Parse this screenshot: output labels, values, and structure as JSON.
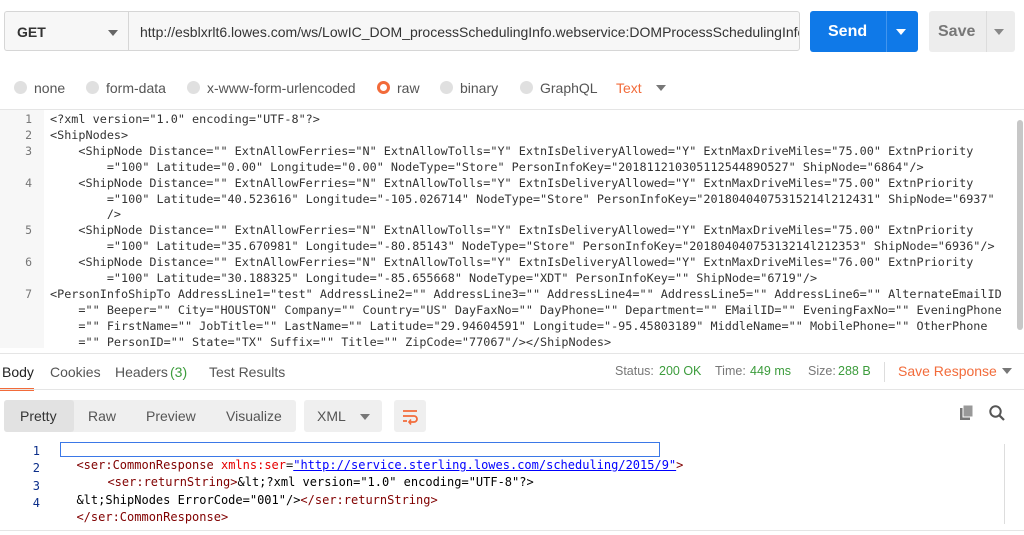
{
  "request": {
    "method": "GET",
    "url": "http://esblxrlt6.lowes.com/ws/LowIC_DOM_processSchedulingInfo.webservice:DOMProcessSchedulingInfo",
    "send_label": "Send",
    "save_label": "Save"
  },
  "body_types": [
    {
      "label": "none",
      "selected": false
    },
    {
      "label": "form-data",
      "selected": false
    },
    {
      "label": "x-www-form-urlencoded",
      "selected": false
    },
    {
      "label": "raw",
      "selected": true
    },
    {
      "label": "binary",
      "selected": false
    },
    {
      "label": "GraphQL",
      "selected": false
    }
  ],
  "raw_format": "Text",
  "request_body": {
    "line_numbers": [
      "1",
      "2",
      "3",
      "4",
      "5",
      "6",
      "7"
    ],
    "lines": [
      "<?xml version=\"1.0\" encoding=\"UTF-8\"?>",
      "<ShipNodes>",
      "    <ShipNode Distance=\"\" ExtnAllowFerries=\"N\" ExtnAllowTolls=\"Y\" ExtnIsDeliveryAllowed=\"Y\" ExtnMaxDriveMiles=\"75.00\" ExtnPriority",
      "        =\"100\" Latitude=\"0.00\" Longitude=\"0.00\" NodeType=\"Store\" PersonInfoKey=\"20181121030511254489O527\" ShipNode=\"6864\"/>",
      "    <ShipNode Distance=\"\" ExtnAllowFerries=\"N\" ExtnAllowTolls=\"Y\" ExtnIsDeliveryAllowed=\"Y\" ExtnMaxDriveMiles=\"75.00\" ExtnPriority",
      "        =\"100\" Latitude=\"40.523616\" Longitude=\"-105.026714\" NodeType=\"Store\" PersonInfoKey=\"20180404075315214l212431\" ShipNode=\"6937\"",
      "        />",
      "    <ShipNode Distance=\"\" ExtnAllowFerries=\"N\" ExtnAllowTolls=\"Y\" ExtnIsDeliveryAllowed=\"Y\" ExtnMaxDriveMiles=\"75.00\" ExtnPriority",
      "        =\"100\" Latitude=\"35.670981\" Longitude=\"-80.85143\" NodeType=\"Store\" PersonInfoKey=\"20180404075313214l212353\" ShipNode=\"6936\"/>",
      "    <ShipNode Distance=\"\" ExtnAllowFerries=\"N\" ExtnAllowTolls=\"Y\" ExtnIsDeliveryAllowed=\"Y\" ExtnMaxDriveMiles=\"76.00\" ExtnPriority",
      "        =\"100\" Latitude=\"30.188325\" Longitude=\"-85.655668\" NodeType=\"XDT\" PersonInfoKey=\"\" ShipNode=\"6719\"/>",
      "<PersonInfoShipTo AddressLine1=\"test\" AddressLine2=\"\" AddressLine3=\"\" AddressLine4=\"\" AddressLine5=\"\" AddressLine6=\"\" AlternateEmailID",
      "    =\"\" Beeper=\"\" City=\"HOUSTON\" Company=\"\" Country=\"US\" DayFaxNo=\"\" DayPhone=\"\" Department=\"\" EMailID=\"\" EveningFaxNo=\"\" EveningPhone",
      "    =\"\" FirstName=\"\" JobTitle=\"\" LastName=\"\" Latitude=\"29.94604591\" Longitude=\"-95.45803189\" MiddleName=\"\" MobilePhone=\"\" OtherPhone",
      "    =\"\" PersonID=\"\" State=\"TX\" Suffix=\"\" Title=\"\" ZipCode=\"77067\"/></ShipNodes>"
    ]
  },
  "response_tabs": {
    "body": "Body",
    "cookies": "Cookies",
    "headers": "Headers",
    "headers_count": "(3)",
    "test_results": "Test Results"
  },
  "response_status": {
    "status_label": "Status:",
    "status_value": "200 OK",
    "time_label": "Time:",
    "time_value": "449 ms",
    "size_label": "Size:",
    "size_value": "288 B",
    "save_response": "Save Response"
  },
  "view_modes": [
    "Pretty",
    "Raw",
    "Preview",
    "Visualize"
  ],
  "response_format": "XML",
  "response_body": {
    "line_numbers": [
      "1",
      "2",
      "3",
      "4"
    ],
    "l1_tag": "<ser:CommonResponse",
    "l1_attr": "xmlns:ser",
    "l1_eq": "=",
    "l1_val": "\"http://service.sterling.lowes.com/scheduling/2015/9\"",
    "l1_end": ">",
    "l2_tag": "<ser:returnString>",
    "l2_text": "&lt;?xml version=\"1.0\" encoding=\"UTF-8\"?>",
    "l3_text": "&lt;ShipNodes ErrorCode=\"001\"/>",
    "l3_tag": "</ser:returnString>",
    "l4_tag": "</ser:CommonResponse>"
  },
  "icons": {
    "copy": "copy-icon",
    "search": "search-icon",
    "wrap": "wrap-lines-icon"
  },
  "colors": {
    "accent": "#f26b3a",
    "send": "#0f79e8",
    "status_ok": "#3c9c3c"
  }
}
